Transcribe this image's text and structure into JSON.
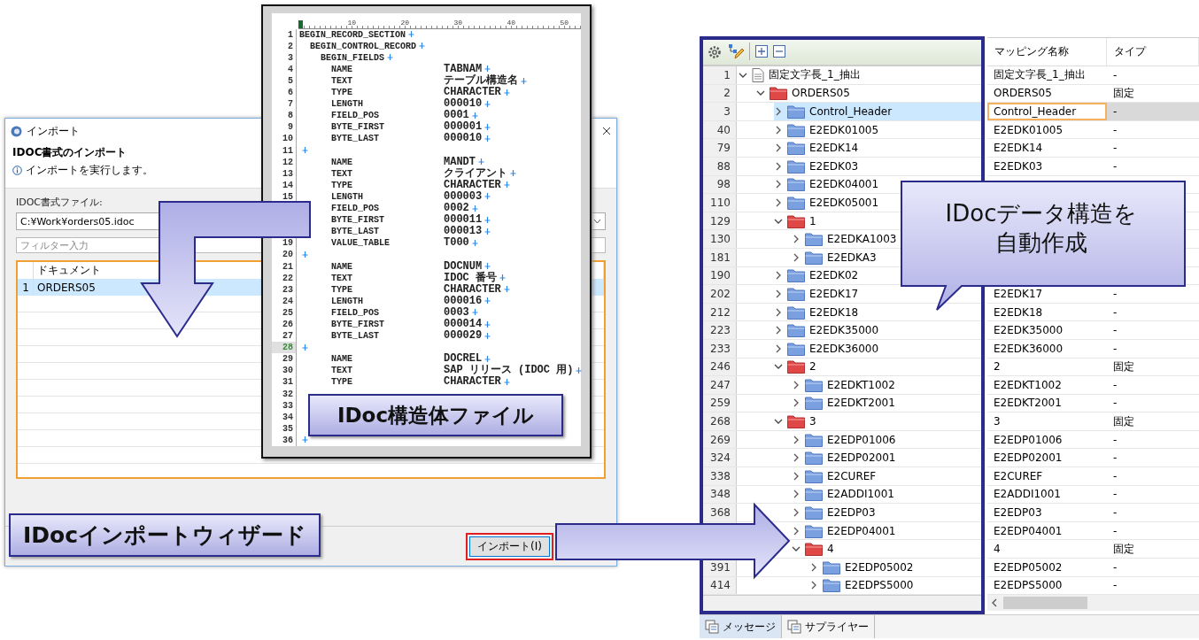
{
  "import_dialog": {
    "title": "インポート",
    "heading": "IDOC書式のインポート",
    "message": "インポートを実行します。",
    "file_label": "IDOC書式ファイル:",
    "file_value": "C:¥Work¥orders05.idoc",
    "filter_placeholder": "フィルター入力",
    "table": {
      "columns": [
        "ドキュメント"
      ],
      "rows": [
        {
          "num": "1",
          "document": "ORDERS05",
          "selected": true
        }
      ]
    },
    "buttons": [
      {
        "label": "インポート(I)",
        "highlighted": true
      }
    ]
  },
  "editor": {
    "ruler": [
      "10",
      "20",
      "30",
      "40",
      "50"
    ],
    "lines": [
      {
        "num": "1",
        "kind": "section",
        "text": "BEGIN_RECORD_SECTION",
        "eol": true,
        "current": false
      },
      {
        "num": "2",
        "kind": "section",
        "text": "  BEGIN_CONTROL_RECORD",
        "eol": true,
        "current": false
      },
      {
        "num": "3",
        "kind": "section",
        "text": "    BEGIN_FIELDS",
        "eol": true,
        "current": false
      },
      {
        "num": "4",
        "kind": "field",
        "name": "NAME",
        "value": "TABNAM",
        "eol": true,
        "current": false
      },
      {
        "num": "5",
        "kind": "field",
        "name": "TEXT",
        "value": "テーブル構造名",
        "eol": true,
        "current": false
      },
      {
        "num": "6",
        "kind": "field",
        "name": "TYPE",
        "value": "CHARACTER",
        "eol": true,
        "current": false
      },
      {
        "num": "7",
        "kind": "field",
        "name": "LENGTH",
        "value": "000010",
        "eol": true,
        "current": false
      },
      {
        "num": "8",
        "kind": "field",
        "name": "FIELD_POS",
        "value": "0001",
        "eol": true,
        "current": false
      },
      {
        "num": "9",
        "kind": "field",
        "name": "BYTE_FIRST",
        "value": "000001",
        "eol": true,
        "current": false
      },
      {
        "num": "10",
        "kind": "field",
        "name": "BYTE_LAST",
        "value": "000010",
        "eol": true,
        "current": false
      },
      {
        "num": "11",
        "kind": "blank",
        "eol": true,
        "current": false
      },
      {
        "num": "12",
        "kind": "field",
        "name": "NAME",
        "value": "MANDT",
        "eol": true,
        "current": false
      },
      {
        "num": "13",
        "kind": "field",
        "name": "TEXT",
        "value": "クライアント",
        "eol": true,
        "current": false
      },
      {
        "num": "14",
        "kind": "field",
        "name": "TYPE",
        "value": "CHARACTER",
        "eol": true,
        "current": false
      },
      {
        "num": "15",
        "kind": "field",
        "name": "LENGTH",
        "value": "000003",
        "eol": true,
        "current": false
      },
      {
        "kind": "field",
        "name": "FIELD_POS",
        "value": "0002",
        "eol": true,
        "current": false
      },
      {
        "kind": "field",
        "name": "BYTE_FIRST",
        "value": "000011",
        "eol": true,
        "current": false
      },
      {
        "kind": "field",
        "name": "BYTE_LAST",
        "value": "000013",
        "eol": true,
        "current": false
      },
      {
        "num": "19",
        "kind": "field",
        "name": "VALUE_TABLE",
        "value": "T000",
        "eol": true,
        "current": false
      },
      {
        "num": "20",
        "kind": "blank",
        "eol": true,
        "current": false
      },
      {
        "num": "21",
        "kind": "field",
        "name": "NAME",
        "value": "DOCNUM",
        "eol": true,
        "current": false
      },
      {
        "num": "22",
        "kind": "field",
        "name": "TEXT",
        "value": "IDOC 番号",
        "eol": true,
        "current": false
      },
      {
        "num": "23",
        "kind": "field",
        "name": "TYPE",
        "value": "CHARACTER",
        "eol": true,
        "current": false
      },
      {
        "num": "24",
        "kind": "field",
        "name": "LENGTH",
        "value": "000016",
        "eol": true,
        "current": false
      },
      {
        "num": "25",
        "kind": "field",
        "name": "FIELD_POS",
        "value": "0003",
        "eol": true,
        "current": false
      },
      {
        "num": "26",
        "kind": "field",
        "name": "BYTE_FIRST",
        "value": "000014",
        "eol": true,
        "current": false
      },
      {
        "num": "27",
        "kind": "field",
        "name": "BYTE_LAST",
        "value": "000029",
        "eol": true,
        "current": false
      },
      {
        "num": "28",
        "kind": "blank",
        "eol": true,
        "current": true
      },
      {
        "num": "29",
        "kind": "field",
        "name": "NAME",
        "value": "DOCREL",
        "eol": true,
        "current": false
      },
      {
        "num": "30",
        "kind": "field",
        "name": "TEXT",
        "value": "SAP リリース (IDOC 用)",
        "eol": true,
        "current": false
      },
      {
        "num": "31",
        "kind": "field",
        "name": "TYPE",
        "value": "CHARACTER",
        "eol": true,
        "current": false
      },
      {
        "num": "32",
        "kind": "blank",
        "eol": false,
        "current": false
      },
      {
        "num": "33",
        "kind": "blank",
        "eol": false,
        "current": false
      },
      {
        "num": "34",
        "kind": "blank",
        "eol": false,
        "current": false
      },
      {
        "num": "35",
        "kind": "blank",
        "eol": false,
        "current": false
      },
      {
        "num": "36",
        "kind": "blank",
        "eol": true,
        "current": false
      }
    ]
  },
  "mapping_view": {
    "columns": [
      "マッピング名称",
      "タイプ"
    ],
    "tree": [
      {
        "num": "1",
        "label": "固定文字長_1_抽出",
        "kind": "document",
        "expanded": true,
        "selected": false,
        "mapping": "固定文字長_1_抽出",
        "type": "-",
        "children": [
          {
            "num": "2",
            "label": "ORDERS05",
            "kind": "group",
            "expanded": true,
            "selected": false,
            "mapping": "ORDERS05",
            "type": "固定",
            "children": [
              {
                "num": "3",
                "label": "Control_Header",
                "kind": "segment",
                "expanded": false,
                "selected": true,
                "mapping": "Control_Header",
                "type": "-"
              },
              {
                "num": "40",
                "label": "E2EDK01005",
                "kind": "segment",
                "expanded": false,
                "selected": false,
                "mapping": "E2EDK01005",
                "type": "-"
              },
              {
                "num": "79",
                "label": "E2EDK14",
                "kind": "segment",
                "expanded": false,
                "selected": false,
                "mapping": "E2EDK14",
                "type": "-"
              },
              {
                "num": "88",
                "label": "E2EDK03",
                "kind": "segment",
                "expanded": false,
                "selected": false,
                "mapping": "E2EDK03",
                "type": "-"
              },
              {
                "num": "98",
                "label": "E2EDK04001",
                "kind": "segment",
                "expanded": false,
                "selected": false
              },
              {
                "num": "110",
                "label": "E2EDK05001",
                "kind": "segment",
                "expanded": false,
                "selected": false
              },
              {
                "num": "129",
                "label": "1",
                "kind": "group",
                "expanded": true,
                "selected": false,
                "children": [
                  {
                    "num": "130",
                    "label": "E2EDKA1003",
                    "kind": "segment",
                    "expanded": false,
                    "selected": false
                  },
                  {
                    "num": "181",
                    "label": "E2EDKA3",
                    "kind": "segment",
                    "expanded": false,
                    "selected": false
                  }
                ]
              },
              {
                "num": "190",
                "label": "E2EDK02",
                "kind": "segment",
                "expanded": false,
                "selected": false
              },
              {
                "num": "202",
                "label": "E2EDK17",
                "kind": "segment",
                "expanded": false,
                "selected": false,
                "mapping": "E2EDK17",
                "type": "-"
              },
              {
                "num": "212",
                "label": "E2EDK18",
                "kind": "segment",
                "expanded": false,
                "selected": false,
                "mapping": "E2EDK18",
                "type": "-"
              },
              {
                "num": "223",
                "label": "E2EDK35000",
                "kind": "segment",
                "expanded": false,
                "selected": false,
                "mapping": "E2EDK35000",
                "type": "-"
              },
              {
                "num": "233",
                "label": "E2EDK36000",
                "kind": "segment",
                "expanded": false,
                "selected": false,
                "mapping": "E2EDK36000",
                "type": "-"
              },
              {
                "num": "246",
                "label": "2",
                "kind": "group",
                "expanded": true,
                "selected": false,
                "mapping": "2",
                "type": "固定",
                "children": [
                  {
                    "num": "247",
                    "label": "E2EDKT1002",
                    "kind": "segment",
                    "expanded": false,
                    "selected": false,
                    "mapping": "E2EDKT1002",
                    "type": "-"
                  },
                  {
                    "num": "259",
                    "label": "E2EDKT2001",
                    "kind": "segment",
                    "expanded": false,
                    "selected": false,
                    "mapping": "E2EDKT2001",
                    "type": "-"
                  }
                ]
              },
              {
                "num": "268",
                "label": "3",
                "kind": "group",
                "expanded": true,
                "selected": false,
                "mapping": "3",
                "type": "固定",
                "children": [
                  {
                    "num": "269",
                    "label": "E2EDP01006",
                    "kind": "segment",
                    "expanded": false,
                    "selected": false,
                    "mapping": "E2EDP01006",
                    "type": "-"
                  },
                  {
                    "num": "324",
                    "label": "E2EDP02001",
                    "kind": "segment",
                    "expanded": false,
                    "selected": false,
                    "mapping": "E2EDP02001",
                    "type": "-"
                  },
                  {
                    "num": "338",
                    "label": "E2CUREF",
                    "kind": "segment",
                    "expanded": false,
                    "selected": false,
                    "mapping": "E2CUREF",
                    "type": "-"
                  },
                  {
                    "num": "348",
                    "label": "E2ADDI1001",
                    "kind": "segment",
                    "expanded": false,
                    "selected": false,
                    "mapping": "E2ADDI1001",
                    "type": "-"
                  },
                  {
                    "num": "368",
                    "label": "E2EDP03",
                    "kind": "segment",
                    "expanded": false,
                    "selected": false,
                    "mapping": "E2EDP03",
                    "type": "-"
                  },
                  {
                    "label": "E2EDP04001",
                    "kind": "segment",
                    "expanded": false,
                    "selected": false,
                    "mapping": "E2EDP04001",
                    "type": "-"
                  },
                  {
                    "label": "4",
                    "kind": "group",
                    "expanded": true,
                    "selected": false,
                    "mapping": "4",
                    "type": "固定",
                    "children": [
                      {
                        "num": "391",
                        "label": "E2EDP05002",
                        "kind": "segment",
                        "expanded": false,
                        "selected": false,
                        "mapping": "E2EDP05002",
                        "type": "-"
                      },
                      {
                        "num": "414",
                        "label": "E2EDPS5000",
                        "kind": "segment",
                        "expanded": false,
                        "selected": false,
                        "mapping": "E2EDPS5000",
                        "type": "-"
                      }
                    ]
                  }
                ]
              }
            ]
          }
        ]
      }
    ],
    "tabs": [
      {
        "label": "メッセージ",
        "selected": true
      },
      {
        "label": "サプライヤー",
        "selected": false
      }
    ]
  },
  "callouts": [
    {
      "kind": "label",
      "text": "IDoc構造体ファイル"
    },
    {
      "kind": "label",
      "text": "IDocインポートウィザード"
    },
    {
      "kind": "speech",
      "lines": [
        "IDocデータ構造を",
        "自動作成"
      ]
    }
  ]
}
